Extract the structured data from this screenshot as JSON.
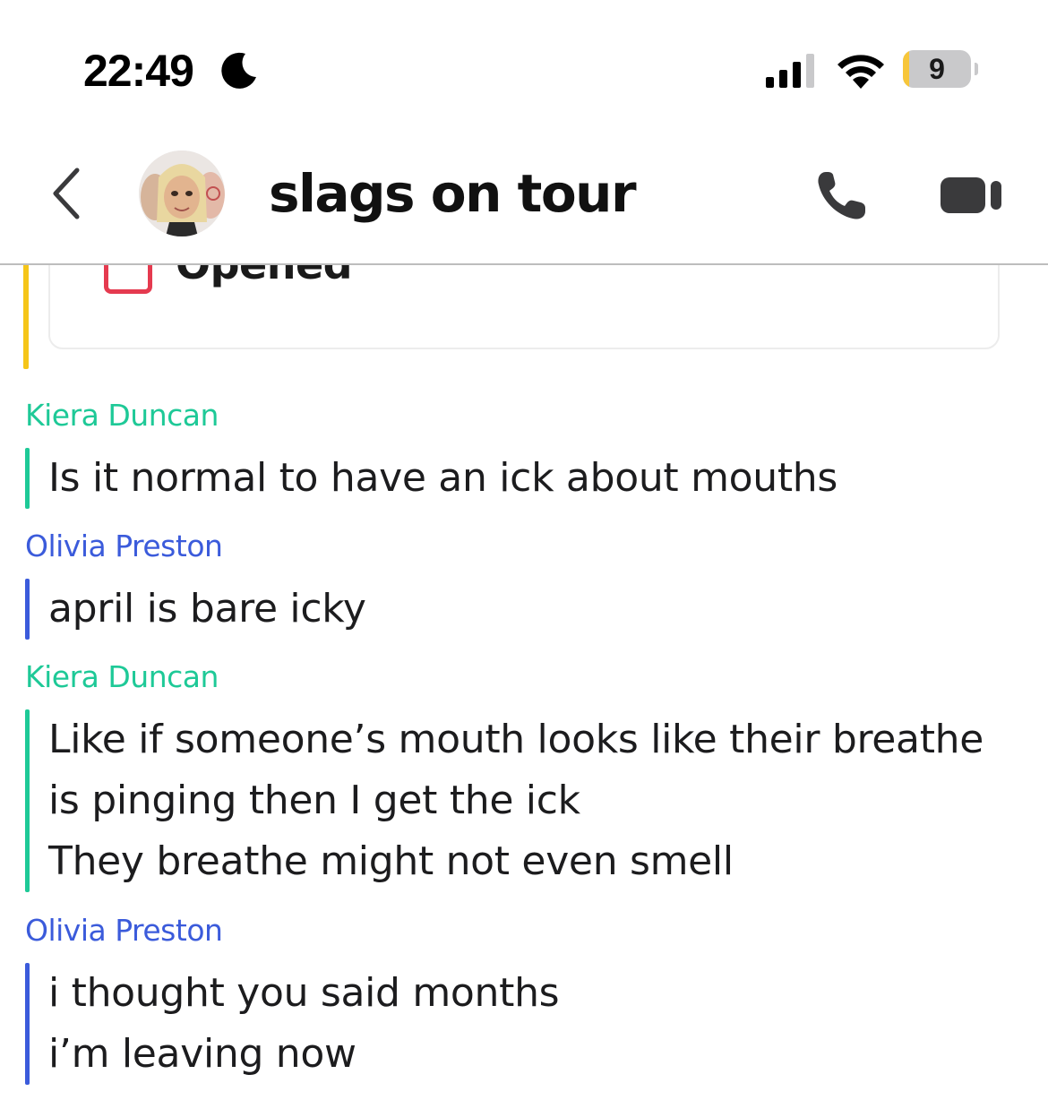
{
  "status_bar": {
    "time": "22:49",
    "battery_level": "9",
    "battery_fraction": 0.09,
    "icons": [
      "moon-icon",
      "signal-icon",
      "wifi-icon",
      "battery-icon"
    ]
  },
  "header": {
    "title": "slags on tour",
    "icons": [
      "back-icon",
      "group-avatar",
      "phone-icon",
      "video-icon"
    ]
  },
  "opened": {
    "label": "Opened",
    "accent_color": "#f5c518",
    "box_color": "#e53a4f"
  },
  "colors": {
    "kiera": "#1ec997",
    "olivia": "#3b5bdb"
  },
  "messages": [
    {
      "sender": "Kiera Duncan",
      "lines": [
        "Is it normal to have an ick about mouths"
      ]
    },
    {
      "sender": "Olivia Preston",
      "lines": [
        "april is bare icky"
      ]
    },
    {
      "sender": "Kiera Duncan",
      "lines": [
        "Like if someone’s mouth looks like their breathe",
        "is pinging then I get the ick",
        "They breathe might not even smell"
      ]
    },
    {
      "sender": "Olivia Preston",
      "lines": [
        "i thought you said months",
        "i’m leaving now"
      ]
    }
  ]
}
